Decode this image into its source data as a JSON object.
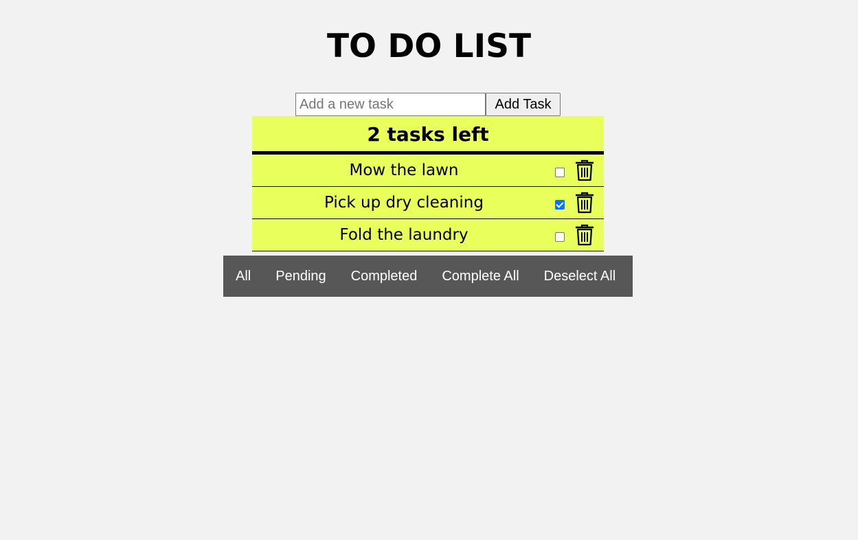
{
  "header": {
    "title": "TO DO LIST"
  },
  "add_task": {
    "input_value": "",
    "input_placeholder": "Add a new task",
    "button_label": "Add Task"
  },
  "summary": {
    "tasks_left_text": "2 tasks left"
  },
  "tasks": [
    {
      "text": "Mow the lawn",
      "completed": false,
      "delete_icon": "trash-icon"
    },
    {
      "text": "Pick up dry cleaning",
      "completed": true,
      "delete_icon": "trash-icon"
    },
    {
      "text": "Fold the laundry",
      "completed": false,
      "delete_icon": "trash-icon"
    }
  ],
  "filters": [
    {
      "label": "All"
    },
    {
      "label": "Pending"
    },
    {
      "label": "Completed"
    },
    {
      "label": "Complete All"
    },
    {
      "label": "Deselect All"
    }
  ],
  "colors": {
    "page_background": "#f2f2f2",
    "list_background": "#e9ff5c",
    "filter_bar_background": "#575757",
    "checkbox_checked": "#0075ff"
  }
}
